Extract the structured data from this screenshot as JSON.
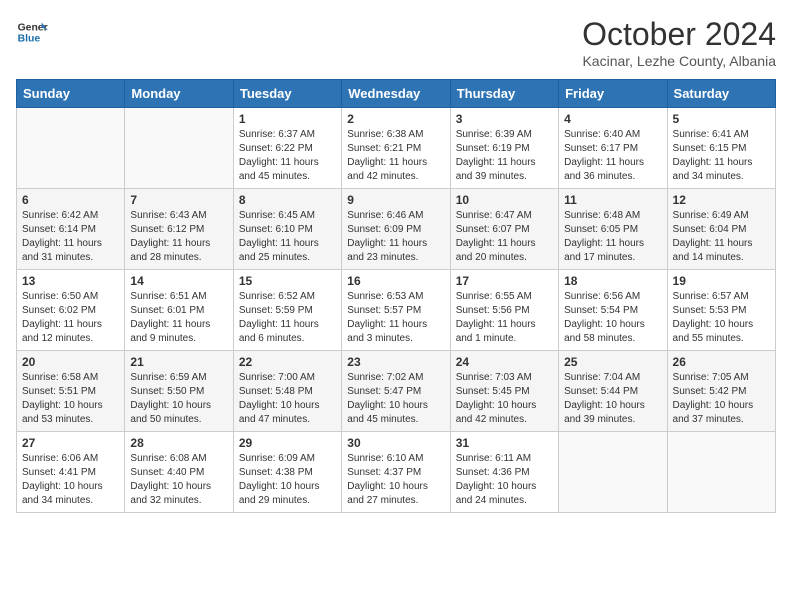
{
  "logo": {
    "line1": "General",
    "line2": "Blue"
  },
  "title": "October 2024",
  "location": "Kacinar, Lezhe County, Albania",
  "days_of_week": [
    "Sunday",
    "Monday",
    "Tuesday",
    "Wednesday",
    "Thursday",
    "Friday",
    "Saturday"
  ],
  "weeks": [
    [
      {
        "num": "",
        "sunrise": "",
        "sunset": "",
        "daylight": ""
      },
      {
        "num": "",
        "sunrise": "",
        "sunset": "",
        "daylight": ""
      },
      {
        "num": "1",
        "sunrise": "Sunrise: 6:37 AM",
        "sunset": "Sunset: 6:22 PM",
        "daylight": "Daylight: 11 hours and 45 minutes."
      },
      {
        "num": "2",
        "sunrise": "Sunrise: 6:38 AM",
        "sunset": "Sunset: 6:21 PM",
        "daylight": "Daylight: 11 hours and 42 minutes."
      },
      {
        "num": "3",
        "sunrise": "Sunrise: 6:39 AM",
        "sunset": "Sunset: 6:19 PM",
        "daylight": "Daylight: 11 hours and 39 minutes."
      },
      {
        "num": "4",
        "sunrise": "Sunrise: 6:40 AM",
        "sunset": "Sunset: 6:17 PM",
        "daylight": "Daylight: 11 hours and 36 minutes."
      },
      {
        "num": "5",
        "sunrise": "Sunrise: 6:41 AM",
        "sunset": "Sunset: 6:15 PM",
        "daylight": "Daylight: 11 hours and 34 minutes."
      }
    ],
    [
      {
        "num": "6",
        "sunrise": "Sunrise: 6:42 AM",
        "sunset": "Sunset: 6:14 PM",
        "daylight": "Daylight: 11 hours and 31 minutes."
      },
      {
        "num": "7",
        "sunrise": "Sunrise: 6:43 AM",
        "sunset": "Sunset: 6:12 PM",
        "daylight": "Daylight: 11 hours and 28 minutes."
      },
      {
        "num": "8",
        "sunrise": "Sunrise: 6:45 AM",
        "sunset": "Sunset: 6:10 PM",
        "daylight": "Daylight: 11 hours and 25 minutes."
      },
      {
        "num": "9",
        "sunrise": "Sunrise: 6:46 AM",
        "sunset": "Sunset: 6:09 PM",
        "daylight": "Daylight: 11 hours and 23 minutes."
      },
      {
        "num": "10",
        "sunrise": "Sunrise: 6:47 AM",
        "sunset": "Sunset: 6:07 PM",
        "daylight": "Daylight: 11 hours and 20 minutes."
      },
      {
        "num": "11",
        "sunrise": "Sunrise: 6:48 AM",
        "sunset": "Sunset: 6:05 PM",
        "daylight": "Daylight: 11 hours and 17 minutes."
      },
      {
        "num": "12",
        "sunrise": "Sunrise: 6:49 AM",
        "sunset": "Sunset: 6:04 PM",
        "daylight": "Daylight: 11 hours and 14 minutes."
      }
    ],
    [
      {
        "num": "13",
        "sunrise": "Sunrise: 6:50 AM",
        "sunset": "Sunset: 6:02 PM",
        "daylight": "Daylight: 11 hours and 12 minutes."
      },
      {
        "num": "14",
        "sunrise": "Sunrise: 6:51 AM",
        "sunset": "Sunset: 6:01 PM",
        "daylight": "Daylight: 11 hours and 9 minutes."
      },
      {
        "num": "15",
        "sunrise": "Sunrise: 6:52 AM",
        "sunset": "Sunset: 5:59 PM",
        "daylight": "Daylight: 11 hours and 6 minutes."
      },
      {
        "num": "16",
        "sunrise": "Sunrise: 6:53 AM",
        "sunset": "Sunset: 5:57 PM",
        "daylight": "Daylight: 11 hours and 3 minutes."
      },
      {
        "num": "17",
        "sunrise": "Sunrise: 6:55 AM",
        "sunset": "Sunset: 5:56 PM",
        "daylight": "Daylight: 11 hours and 1 minute."
      },
      {
        "num": "18",
        "sunrise": "Sunrise: 6:56 AM",
        "sunset": "Sunset: 5:54 PM",
        "daylight": "Daylight: 10 hours and 58 minutes."
      },
      {
        "num": "19",
        "sunrise": "Sunrise: 6:57 AM",
        "sunset": "Sunset: 5:53 PM",
        "daylight": "Daylight: 10 hours and 55 minutes."
      }
    ],
    [
      {
        "num": "20",
        "sunrise": "Sunrise: 6:58 AM",
        "sunset": "Sunset: 5:51 PM",
        "daylight": "Daylight: 10 hours and 53 minutes."
      },
      {
        "num": "21",
        "sunrise": "Sunrise: 6:59 AM",
        "sunset": "Sunset: 5:50 PM",
        "daylight": "Daylight: 10 hours and 50 minutes."
      },
      {
        "num": "22",
        "sunrise": "Sunrise: 7:00 AM",
        "sunset": "Sunset: 5:48 PM",
        "daylight": "Daylight: 10 hours and 47 minutes."
      },
      {
        "num": "23",
        "sunrise": "Sunrise: 7:02 AM",
        "sunset": "Sunset: 5:47 PM",
        "daylight": "Daylight: 10 hours and 45 minutes."
      },
      {
        "num": "24",
        "sunrise": "Sunrise: 7:03 AM",
        "sunset": "Sunset: 5:45 PM",
        "daylight": "Daylight: 10 hours and 42 minutes."
      },
      {
        "num": "25",
        "sunrise": "Sunrise: 7:04 AM",
        "sunset": "Sunset: 5:44 PM",
        "daylight": "Daylight: 10 hours and 39 minutes."
      },
      {
        "num": "26",
        "sunrise": "Sunrise: 7:05 AM",
        "sunset": "Sunset: 5:42 PM",
        "daylight": "Daylight: 10 hours and 37 minutes."
      }
    ],
    [
      {
        "num": "27",
        "sunrise": "Sunrise: 6:06 AM",
        "sunset": "Sunset: 4:41 PM",
        "daylight": "Daylight: 10 hours and 34 minutes."
      },
      {
        "num": "28",
        "sunrise": "Sunrise: 6:08 AM",
        "sunset": "Sunset: 4:40 PM",
        "daylight": "Daylight: 10 hours and 32 minutes."
      },
      {
        "num": "29",
        "sunrise": "Sunrise: 6:09 AM",
        "sunset": "Sunset: 4:38 PM",
        "daylight": "Daylight: 10 hours and 29 minutes."
      },
      {
        "num": "30",
        "sunrise": "Sunrise: 6:10 AM",
        "sunset": "Sunset: 4:37 PM",
        "daylight": "Daylight: 10 hours and 27 minutes."
      },
      {
        "num": "31",
        "sunrise": "Sunrise: 6:11 AM",
        "sunset": "Sunset: 4:36 PM",
        "daylight": "Daylight: 10 hours and 24 minutes."
      },
      {
        "num": "",
        "sunrise": "",
        "sunset": "",
        "daylight": ""
      },
      {
        "num": "",
        "sunrise": "",
        "sunset": "",
        "daylight": ""
      }
    ]
  ]
}
